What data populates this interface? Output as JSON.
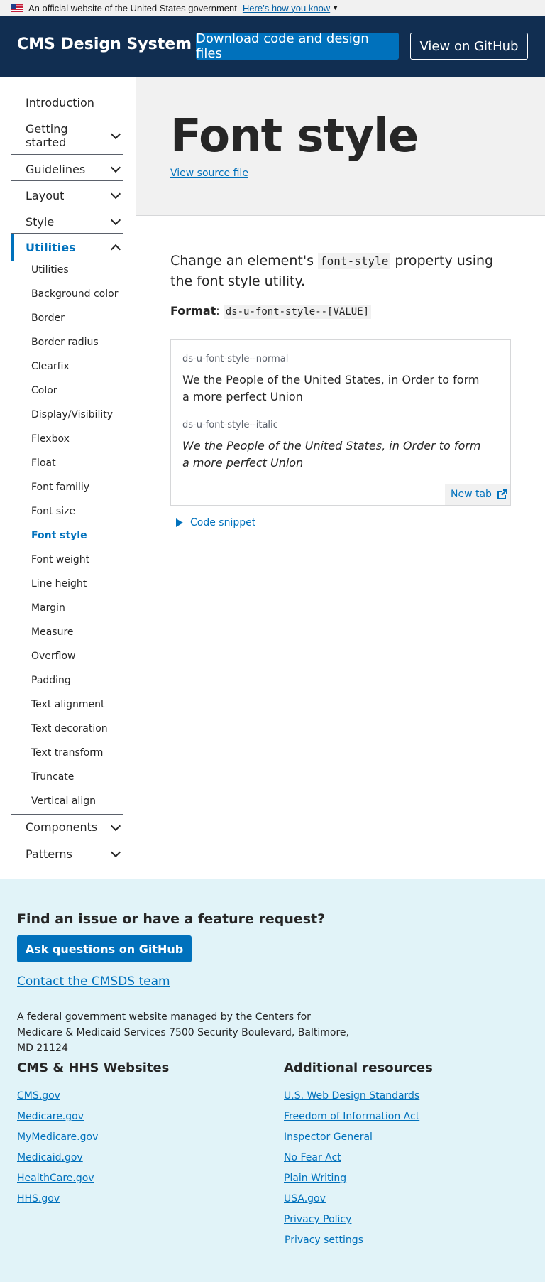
{
  "banner": {
    "official_text": "An official website of the United States government",
    "how_text": "Here’s how you know"
  },
  "header": {
    "title": "CMS Design System",
    "download_label": "Download code and design files",
    "github_label": "View on GitHub"
  },
  "sidebar": {
    "top_items": [
      {
        "label": "Introduction"
      },
      {
        "label": "Getting started"
      },
      {
        "label": "Guidelines"
      },
      {
        "label": "Layout"
      },
      {
        "label": "Style"
      },
      {
        "label": "Utilities"
      },
      {
        "label": "Components"
      },
      {
        "label": "Patterns"
      }
    ],
    "utilities_items": [
      "Utilities",
      "Background color",
      "Border",
      "Border radius",
      "Clearfix",
      "Color",
      "Display/Visibility",
      "Flexbox",
      "Float",
      "Font familiy",
      "Font size",
      "Font style",
      "Font weight",
      "Line height",
      "Margin",
      "Measure",
      "Overflow",
      "Padding",
      "Text alignment",
      "Text decoration",
      "Text transform",
      "Truncate",
      "Vertical align"
    ]
  },
  "hero": {
    "title": "Font style",
    "view_source": "View source file"
  },
  "main": {
    "lead_before": "Change an element's",
    "lead_code": "font-style",
    "lead_after": "property using the font style utility.",
    "format_label": "Format",
    "format_code": "ds-u-font-style--[VALUE]",
    "examples": [
      {
        "label": "ds-u-font-style--normal",
        "text": "We the People of the United States, in Order to form a more perfect Union"
      },
      {
        "label": "ds-u-font-style--italic",
        "text": "We the People of the United States, in Order to form a more perfect Union"
      }
    ],
    "new_tab": "New tab",
    "code_snippet": "Code snippet"
  },
  "footer": {
    "heading": "Find an issue or have a feature request?",
    "ask_button": "Ask questions on GitHub",
    "contact": "Contact the CMSDS team",
    "description": "A federal government website managed by the Centers for Medicare & Medicaid Services 7500 Security Boulevard, Baltimore, MD 21124",
    "col1_title": "CMS & HHS Websites",
    "col1_links": [
      "CMS.gov",
      "Medicare.gov",
      "MyMedicare.gov",
      "Medicaid.gov",
      "HealthCare.gov",
      "HHS.gov"
    ],
    "col2_title": "Additional resources",
    "col2_links": [
      "U.S. Web Design Standards",
      "Freedom of Information Act",
      "Inspector General",
      "No Fear Act",
      "Plain Writing",
      "USA.gov",
      "Privacy Policy",
      "Privacy settings"
    ]
  }
}
